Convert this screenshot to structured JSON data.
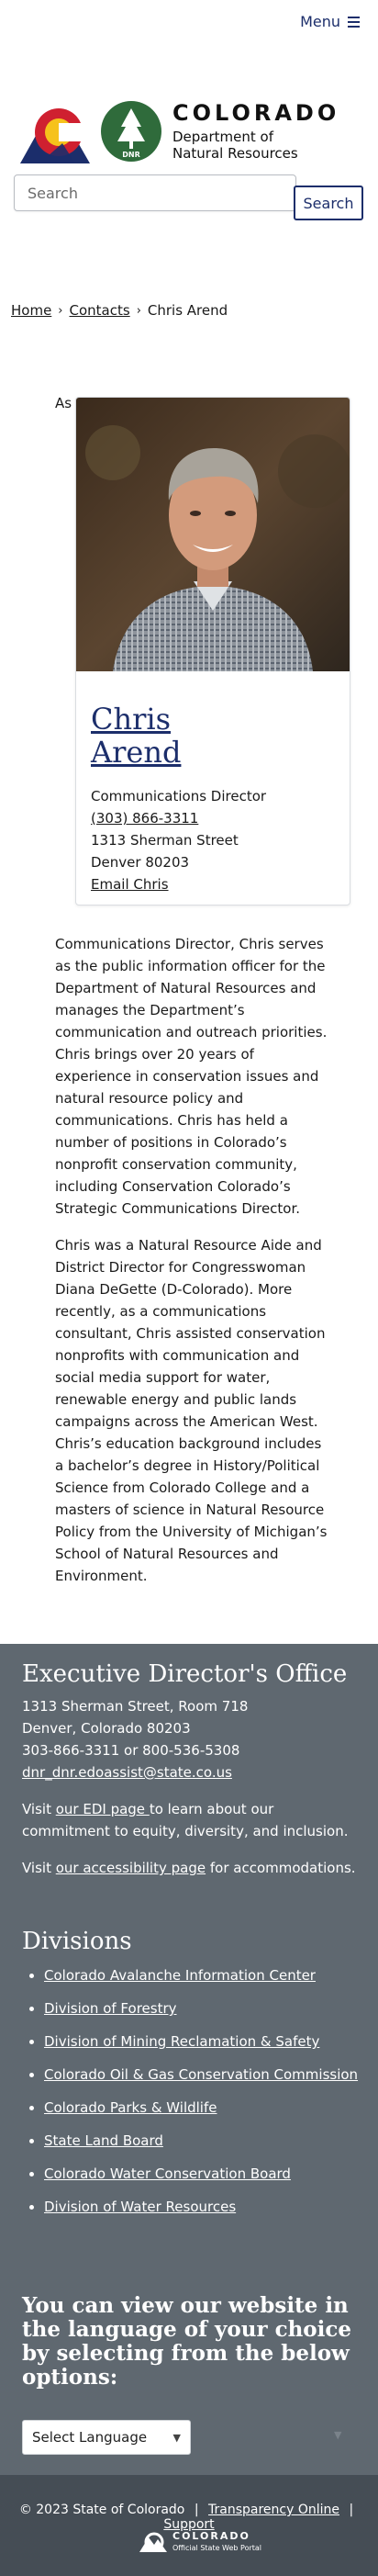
{
  "header": {
    "menu_label": "Menu",
    "logo_state": "COLORADO",
    "logo_dept_line1": "Department of",
    "logo_dept_line2": "Natural Resources",
    "logo_badge": "DNR",
    "search_placeholder": "Search",
    "search_button": "Search"
  },
  "breadcrumb": {
    "home": "Home",
    "contacts": "Contacts",
    "current": "Chris Arend",
    "separator": "›"
  },
  "profile": {
    "as_label": "As",
    "name_line1": "Chris",
    "name_line2": "Arend",
    "title": "Communications Director",
    "phone": "(303) 866-3311",
    "street": "1313 Sherman Street",
    "city": "Denver 80203",
    "email_link": "Email Chris"
  },
  "bio": {
    "p1": "Communications Director, Chris serves as the public information officer for the Department of Natural Resources and manages the Department’s communication and outreach priorities. Chris brings over 20 years of experience in conservation issues and natural resource policy and communications. Chris has held a number of positions in Colorado’s nonprofit conservation community, including Conservation Colorado’s Strategic Communications Director.",
    "p2": "Chris was a Natural Resource Aide and District Director for Congresswoman Diana DeGette (D-Colorado). More recently, as a communications consultant, Chris assisted conservation nonprofits with communication and social media support for water, renewable energy and public lands campaigns across the American West. Chris’s education background includes a bachelor’s degree in History/Political Science from Colorado College and a masters of science in Natural Resource Policy from the University of Michigan’s School of Natural Resources and Environment."
  },
  "footer": {
    "exec_title": "Executive Director's Office",
    "address1": "1313 Sherman Street, Room 718",
    "address2": "Denver, Colorado 80203",
    "phones": "303-866-3311 or 800-536-5308",
    "email": "dnr_dnr.edoassist@state.co.us",
    "edi_prefix": "Visit ",
    "edi_link": "our EDI page ",
    "edi_suffix": "to learn about our commitment to equity, diversity, and inclusion.",
    "access_prefix": "Visit ",
    "access_link": "our accessibility page",
    "access_suffix": " for accommodations.",
    "divisions_title": "Divisions",
    "divisions": [
      "Colorado Avalanche Information Center",
      "Division of Forestry",
      "Division of Mining Reclamation & Safety",
      "Colorado Oil & Gas Conservation Commission",
      "Colorado Parks & Wildlife",
      "State Land Board",
      "Colorado Water Conservation Board",
      "Division of Water Resources"
    ],
    "language_heading": "You can view our website in the language of your choice by selecting from the below options:",
    "language_select": "Select Language",
    "copyright": "© 2023 State of Colorado",
    "transparency": "Transparency Online",
    "support": "Support",
    "portal_title": "COLORADO",
    "portal_sub": "Official State Web Portal"
  },
  "colors": {
    "brand_navy": "#1c2e6b",
    "footer_bg": "#5f6870",
    "bottom_bar_bg": "#454d55"
  }
}
